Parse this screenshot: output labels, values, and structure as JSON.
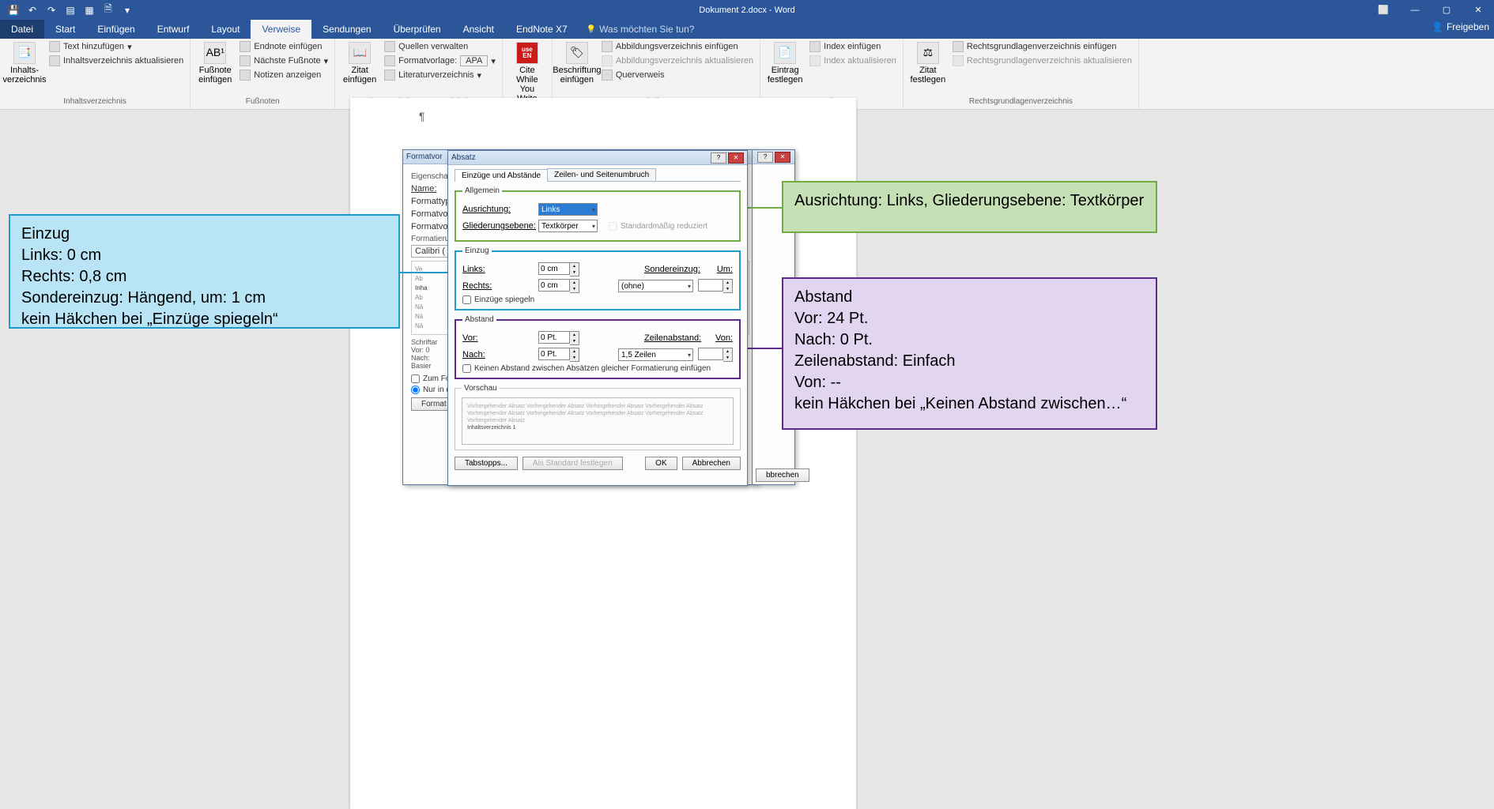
{
  "title": "Dokument 2.docx - Word",
  "tabs": {
    "file": "Datei",
    "home": "Start",
    "insert": "Einfügen",
    "design": "Entwurf",
    "layout": "Layout",
    "references": "Verweise",
    "mailings": "Sendungen",
    "review": "Überprüfen",
    "view": "Ansicht",
    "endnote": "EndNote X7",
    "tell_me": "Was möchten Sie tun?",
    "share": "Freigeben"
  },
  "ribbon": {
    "g1": {
      "title": "Inhaltsverzeichnis",
      "big": "Inhalts-\nverzeichnis",
      "a": "Text hinzufügen",
      "b": "Inhaltsverzeichnis aktualisieren"
    },
    "g2": {
      "title": "Fußnoten",
      "big": "Fußnote\neinfügen",
      "a": "Endnote einfügen",
      "b": "Nächste Fußnote",
      "c": "Notizen anzeigen"
    },
    "g3": {
      "title": "Zitate und Literaturverzeichnis",
      "big": "Zitat\neinfügen",
      "a": "Quellen verwalten",
      "b": "Formatvorlage:",
      "b_val": "APA",
      "c": "Literaturverzeichnis"
    },
    "g4": {
      "title": "EndNote",
      "big": "Cite While\nYou Write"
    },
    "g5": {
      "title": "Beschriftungen",
      "big": "Beschriftung\neinfügen",
      "a": "Abbildungsverzeichnis einfügen",
      "b": "Abbildungsverzeichnis aktualisieren",
      "c": "Querverweis"
    },
    "g6": {
      "title": "Index",
      "big": "Eintrag\nfestlegen",
      "a": "Index einfügen",
      "b": "Index aktualisieren"
    },
    "g7": {
      "title": "Rechtsgrundlagenverzeichnis",
      "big": "Zitat\nfestlegen",
      "a": "Rechtsgrundlagenverzeichnis einfügen",
      "b": "Rechtsgrundlagenverzeichnis aktualisieren"
    }
  },
  "back_dialog": {
    "title": "Formatvor",
    "sec1": "Eigenschaft",
    "name": "Name:",
    "type": "Formattyp",
    "based": "Formatvo",
    "next": "Formatvo",
    "sec2": "Formatieru",
    "font": "Calibri (",
    "para_preview_1": "Ve",
    "para_preview_2": "Ab",
    "para_preview_3": "Inha",
    "para_preview_4": "Ab",
    "para_preview_5": "Nä",
    "para_preview_6": "Nä",
    "para_preview_7": "Nä",
    "desc1": "Schriftar",
    "desc2": "Vor: 0",
    "desc3": "Nach:",
    "desc4": "Basier",
    "chk_add": "Zum Fo",
    "radio_this": "Nur in d",
    "btn_format": "Format",
    "btn_cancel_frag": "bbrechen"
  },
  "absatz": {
    "title": "Absatz",
    "tab1": "Einzüge und Abstände",
    "tab2": "Zeilen- und Seitenumbruch",
    "allgemein": {
      "legend": "Allgemein",
      "ausrichtung": "Ausrichtung:",
      "ausrichtung_val": "Links",
      "gliederung": "Gliederungsebene:",
      "gliederung_val": "Textkörper",
      "reduziert": "Standardmäßig reduziert"
    },
    "einzug": {
      "legend": "Einzug",
      "links": "Links:",
      "links_val": "0 cm",
      "rechts": "Rechts:",
      "rechts_val": "0 cm",
      "sonder": "Sondereinzug:",
      "sonder_val": "(ohne)",
      "um": "Um:",
      "spiegeln": "Einzüge spiegeln"
    },
    "abstand": {
      "legend": "Abstand",
      "vor": "Vor:",
      "vor_val": "0 Pt.",
      "nach": "Nach:",
      "nach_val": "0 Pt.",
      "zeilen": "Zeilenabstand:",
      "zeilen_val": "1,5 Zeilen",
      "von": "Von:",
      "keinen": "Keinen Abstand zwischen Absätzen gleicher Formatierung einfügen"
    },
    "vorschau": {
      "legend": "Vorschau",
      "filler": "Vorhergehender Absatz Vorhergehender Absatz Vorhergehender Absatz Vorhergehender Absatz Vorhergehender Absatz Vorhergehender Absatz Vorhergehender Absatz Vorhergehender Absatz Vorhergehender Absatz",
      "sample": "Inhaltsverzeichnis 1"
    },
    "btn_tab": "Tabstopps...",
    "btn_default": "Als Standard festlegen",
    "btn_ok": "OK",
    "btn_cancel": "Abbrechen"
  },
  "callouts": {
    "blue": "Einzug\nLinks: 0 cm\nRechts: 0,8 cm\nSondereinzug: Hängend, um: 1 cm\nkein Häkchen bei „Einzüge spiegeln“",
    "green": "Ausrichtung: Links, Gliederungsebene: Textkörper",
    "purple": "Abstand\nVor: 24 Pt.\nNach: 0 Pt.\nZeilenabstand: Einfach\nVon: --\nkein Häkchen bei „Keinen Abstand zwischen…“"
  }
}
